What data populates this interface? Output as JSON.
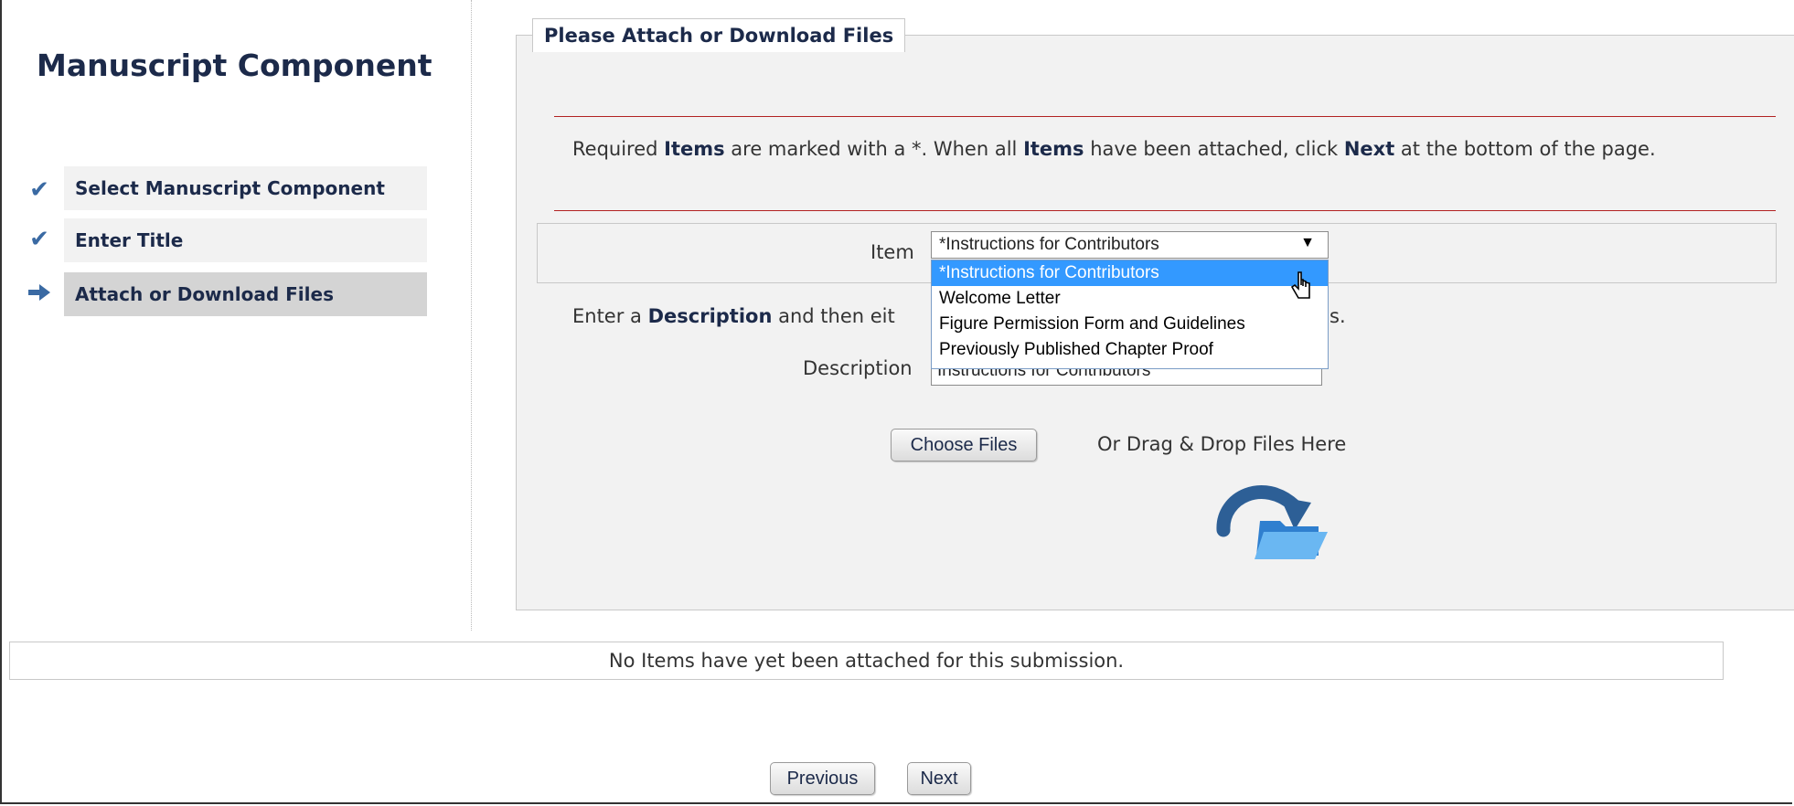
{
  "sidebar": {
    "title": "Manuscript Component",
    "steps": [
      {
        "label": "Select Manuscript Component",
        "status": "done",
        "icon": "checkmark-icon"
      },
      {
        "label": "Enter Title",
        "status": "done",
        "icon": "checkmark-icon"
      },
      {
        "label": "Attach or Download Files",
        "status": "current",
        "icon": "arrow-right-icon"
      }
    ]
  },
  "panel": {
    "legend": "Please Attach or Download Files",
    "instructions": {
      "part1": "Required ",
      "bold1": "Items",
      "part2": " are marked with a *. When all ",
      "bold2": "Items",
      "part3": " have been attached, click ",
      "bold3": "Next",
      "part4": " at the bottom of the page."
    },
    "item_label": "Item",
    "item_selected": "*Instructions for Contributors",
    "item_options": [
      "*Instructions for Contributors",
      "Welcome Letter",
      "Figure Permission Form and Guidelines",
      "Previously Published Chapter Proof"
    ],
    "enter_desc": {
      "part1": "Enter a ",
      "bold1": "Description",
      "part2": " and then eit",
      "tail": "s."
    },
    "description_label": "Description",
    "description_value": "Instructions for Contributors",
    "choose_files": "Choose Files",
    "drag_drop": "Or Drag & Drop Files Here"
  },
  "attached_status": "No Items have yet been attached for this submission.",
  "footer": {
    "previous": "Previous",
    "next": "Next"
  },
  "colors": {
    "accent_navy": "#1c2a4a",
    "divider_red": "#b22222",
    "selected_option": "#3399ff",
    "icon_blue": "#3a6aa3"
  }
}
